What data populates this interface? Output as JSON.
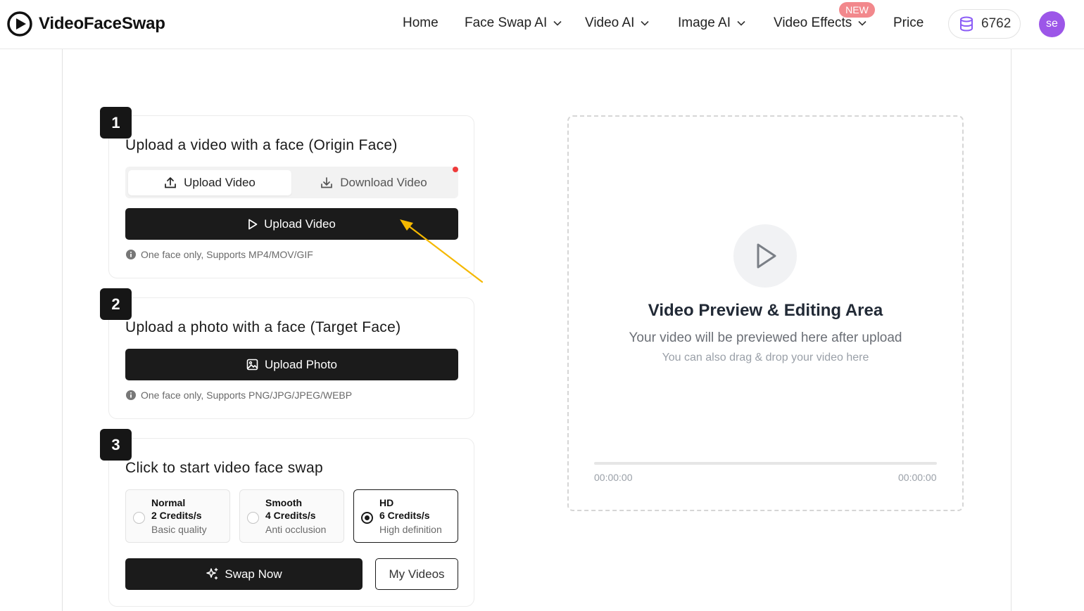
{
  "header": {
    "brand": "VideoFaceSwap",
    "nav": [
      {
        "label": "Home",
        "dropdown": false
      },
      {
        "label": "Face Swap AI",
        "dropdown": true
      },
      {
        "label": "Video AI",
        "dropdown": true
      },
      {
        "label": "Image AI",
        "dropdown": true
      },
      {
        "label": "Video Effects",
        "dropdown": true
      },
      {
        "label": "Price",
        "dropdown": false
      }
    ],
    "new_badge": "NEW",
    "credits": "6762",
    "avatar_initials": "se"
  },
  "step1": {
    "number": "1",
    "title": "Upload a video with a face (Origin Face)",
    "tab_upload": "Upload Video",
    "tab_download": "Download Video",
    "button": "Upload Video",
    "hint": "One face only, Supports MP4/MOV/GIF"
  },
  "step2": {
    "number": "2",
    "title": "Upload a photo with a face  (Target Face)",
    "button": "Upload Photo",
    "hint": "One face only, Supports PNG/JPG/JPEG/WEBP"
  },
  "step3": {
    "number": "3",
    "title": "Click to start video face swap",
    "options": [
      {
        "name": "Normal",
        "credits": "2 Credits/s",
        "desc": "Basic quality",
        "selected": false
      },
      {
        "name": "Smooth",
        "credits": "4 Credits/s",
        "desc": "Anti occlusion",
        "selected": false
      },
      {
        "name": "HD",
        "credits": "6 Credits/s",
        "desc": "High definition",
        "selected": true
      }
    ],
    "swap_button": "Swap Now",
    "my_videos_button": "My Videos"
  },
  "preview": {
    "title": "Video Preview & Editing Area",
    "subtitle": "Your video will be previewed here after upload",
    "hint": "You can also drag & drop your video here",
    "time_start": "00:00:00",
    "time_end": "00:00:00",
    "progress": 0
  },
  "colors": {
    "primary_button": "#1b1b1b",
    "avatar": "#9c56e8",
    "new_badge": "#f2888c",
    "credits_icon": "#8b5cf6",
    "annotation_arrow": "#f5b800"
  }
}
